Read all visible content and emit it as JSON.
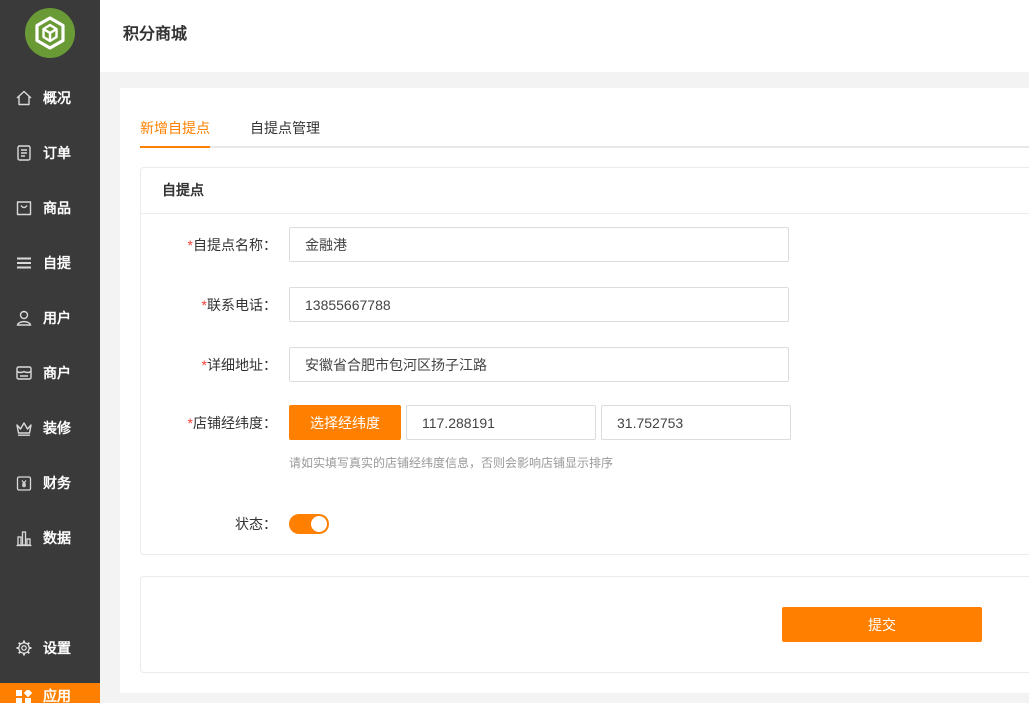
{
  "colors": {
    "accent": "#ff8000",
    "sidebar_bg": "#3a3a3a",
    "logo": "#6a9a36",
    "required": "#f04134"
  },
  "logo": {
    "icon": "hexagon-logo-icon"
  },
  "header": {
    "title": "积分商城"
  },
  "sidebar": {
    "items": [
      {
        "label": "概况",
        "icon": "home-icon"
      },
      {
        "label": "订单",
        "icon": "order-list-icon"
      },
      {
        "label": "商品",
        "icon": "shopping-bag-icon"
      },
      {
        "label": "自提",
        "icon": "menu-lines-icon"
      },
      {
        "label": "用户",
        "icon": "user-icon"
      },
      {
        "label": "商户",
        "icon": "store-card-icon"
      },
      {
        "label": "装修",
        "icon": "crown-icon"
      },
      {
        "label": "财务",
        "icon": "wallet-yen-icon"
      },
      {
        "label": "数据",
        "icon": "bar-chart-icon"
      }
    ],
    "bottom_items": [
      {
        "label": "设置",
        "icon": "gear-icon",
        "active": false
      },
      {
        "label": "应用",
        "icon": "apps-grid-icon",
        "active": true
      }
    ]
  },
  "tabs": [
    {
      "label": "新增自提点",
      "active": true
    },
    {
      "label": "自提点管理",
      "active": false
    }
  ],
  "form": {
    "section_title": "自提点",
    "required_mark": "*",
    "name": {
      "label": "自提点名称：",
      "value": "金融港"
    },
    "phone": {
      "label": "联系电话：",
      "value": "13855667788"
    },
    "address": {
      "label": "详细地址：",
      "value": "安徽省合肥市包河区扬子江路"
    },
    "location": {
      "label": "店铺经纬度：",
      "pick_button": "选择经纬度",
      "longitude": "117.288191",
      "latitude": "31.752753",
      "hint": "请如实填写真实的店铺经纬度信息，否则会影响店铺显示排序"
    },
    "status": {
      "label": "状态：",
      "enabled": true
    }
  },
  "actions": {
    "submit_label": "提交"
  }
}
